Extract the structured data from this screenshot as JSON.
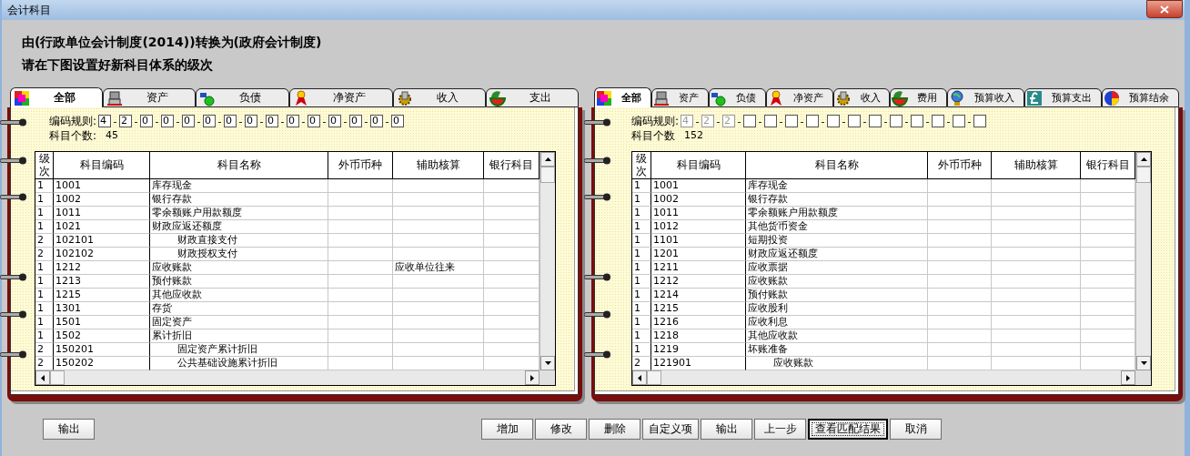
{
  "window": {
    "title": "会计科目"
  },
  "header": [
    "由(行政单位会计制度(2014))转换为(政府会计制度)",
    "请在下图设置好新科目体系的级次"
  ],
  "panels": [
    {
      "tabs": [
        {
          "label": "全部",
          "selected": true
        },
        {
          "label": "资产",
          "selected": false
        },
        {
          "label": "负债",
          "selected": false
        },
        {
          "label": "净资产",
          "selected": false
        },
        {
          "label": "收入",
          "selected": false
        },
        {
          "label": "支出",
          "selected": false
        }
      ],
      "code_rule": {
        "label": "编码规则:",
        "separator": "-",
        "digits": [
          {
            "value": "4",
            "disabled": false
          },
          {
            "value": "2",
            "disabled": false
          },
          {
            "value": "0",
            "disabled": false
          },
          {
            "value": "0",
            "disabled": false
          },
          {
            "value": "0",
            "disabled": false
          },
          {
            "value": "0",
            "disabled": false
          },
          {
            "value": "0",
            "disabled": false
          },
          {
            "value": "0",
            "disabled": false
          },
          {
            "value": "0",
            "disabled": false
          },
          {
            "value": "0",
            "disabled": false
          },
          {
            "value": "0",
            "disabled": false
          },
          {
            "value": "0",
            "disabled": false
          },
          {
            "value": "0",
            "disabled": false
          },
          {
            "value": "0",
            "disabled": false
          },
          {
            "value": "0",
            "disabled": false
          }
        ]
      },
      "count": {
        "label": "科目个数:",
        "value": "45"
      },
      "table": {
        "columns": [
          "级次",
          "科目编码",
          "科目名称",
          "外币币种",
          "辅助核算",
          "银行科目"
        ],
        "rows": [
          {
            "level": "1",
            "code": "1001",
            "name": "库存现金"
          },
          {
            "level": "1",
            "code": "1002",
            "name": "银行存款"
          },
          {
            "level": "1",
            "code": "1011",
            "name": "零余额账户用款额度"
          },
          {
            "level": "1",
            "code": "1021",
            "name": "财政应返还额度",
            "children": [
              {
                "level": "2",
                "code": "102101",
                "name": "财政直接支付"
              },
              {
                "level": "2",
                "code": "102102",
                "name": "财政授权支付"
              }
            ]
          },
          {
            "level": "1",
            "code": "1212",
            "name": "应收账款",
            "auxiliary": "应收单位往来"
          },
          {
            "level": "1",
            "code": "1213",
            "name": "预付账款"
          },
          {
            "level": "1",
            "code": "1215",
            "name": "其他应收款"
          },
          {
            "level": "1",
            "code": "1301",
            "name": "存货"
          },
          {
            "level": "1",
            "code": "1501",
            "name": "固定资产"
          },
          {
            "level": "1",
            "code": "1502",
            "name": "累计折旧",
            "children": [
              {
                "level": "2",
                "code": "150201",
                "name": "固定资产累计折旧"
              },
              {
                "level": "2",
                "code": "150202",
                "name": "公共基础设施累计折旧"
              }
            ]
          }
        ]
      }
    },
    {
      "tabs": [
        {
          "label": "全部",
          "selected": true
        },
        {
          "label": "资产",
          "selected": false
        },
        {
          "label": "负债",
          "selected": false
        },
        {
          "label": "净资产",
          "selected": false
        },
        {
          "label": "收入",
          "selected": false
        },
        {
          "label": "费用",
          "selected": false
        },
        {
          "label": "预算收入",
          "selected": false
        },
        {
          "label": "预算支出",
          "selected": false
        },
        {
          "label": "预算结余",
          "selected": false
        }
      ],
      "code_rule": {
        "label": "编码规则:",
        "separator": "-",
        "digits": [
          {
            "value": "4",
            "disabled": true
          },
          {
            "value": "2",
            "disabled": true
          },
          {
            "value": "2",
            "disabled": true
          },
          {
            "disabled": false
          },
          {
            "disabled": false
          },
          {
            "disabled": false
          },
          {
            "disabled": false
          },
          {
            "disabled": false
          },
          {
            "disabled": false
          },
          {
            "disabled": false
          },
          {
            "disabled": false
          },
          {
            "disabled": false
          },
          {
            "disabled": false
          },
          {
            "disabled": false
          },
          {
            "disabled": false
          }
        ]
      },
      "count": {
        "label": "科目个数",
        "value": "152"
      },
      "table": {
        "columns": [
          "级次",
          "科目编码",
          "科目名称",
          "外币币种",
          "辅助核算",
          "银行科目"
        ],
        "rows": [
          {
            "level": "1",
            "code": "1001",
            "name": "库存现金"
          },
          {
            "level": "1",
            "code": "1002",
            "name": "银行存款"
          },
          {
            "level": "1",
            "code": "1011",
            "name": "零余额账户用款额度"
          },
          {
            "level": "1",
            "code": "1012",
            "name": "其他货币资金"
          },
          {
            "level": "1",
            "code": "1101",
            "name": "短期投资"
          },
          {
            "level": "1",
            "code": "1201",
            "name": "财政应返还额度"
          },
          {
            "level": "1",
            "code": "1211",
            "name": "应收票据"
          },
          {
            "level": "1",
            "code": "1212",
            "name": "应收账款"
          },
          {
            "level": "1",
            "code": "1214",
            "name": "预付账款"
          },
          {
            "level": "1",
            "code": "1215",
            "name": "应收股利"
          },
          {
            "level": "1",
            "code": "1216",
            "name": "应收利息"
          },
          {
            "level": "1",
            "code": "1218",
            "name": "其他应收款"
          },
          {
            "level": "1",
            "code": "1219",
            "name": "坏账准备",
            "children": [
              {
                "level": "2",
                "code": "121901",
                "name": "应收账款"
              }
            ]
          }
        ]
      }
    }
  ],
  "left_buttons": [
    {
      "label": "输出",
      "default": false
    }
  ],
  "right_buttons": [
    {
      "label": "增加",
      "default": false
    },
    {
      "label": "修改",
      "default": false
    },
    {
      "label": "删除",
      "default": false
    },
    {
      "label": "自定义项",
      "default": false
    },
    {
      "label": "输出",
      "default": false
    },
    {
      "label": "上一步",
      "default": false
    },
    {
      "label": "查看匹配结果",
      "default": true
    },
    {
      "label": "取消",
      "default": false
    }
  ]
}
